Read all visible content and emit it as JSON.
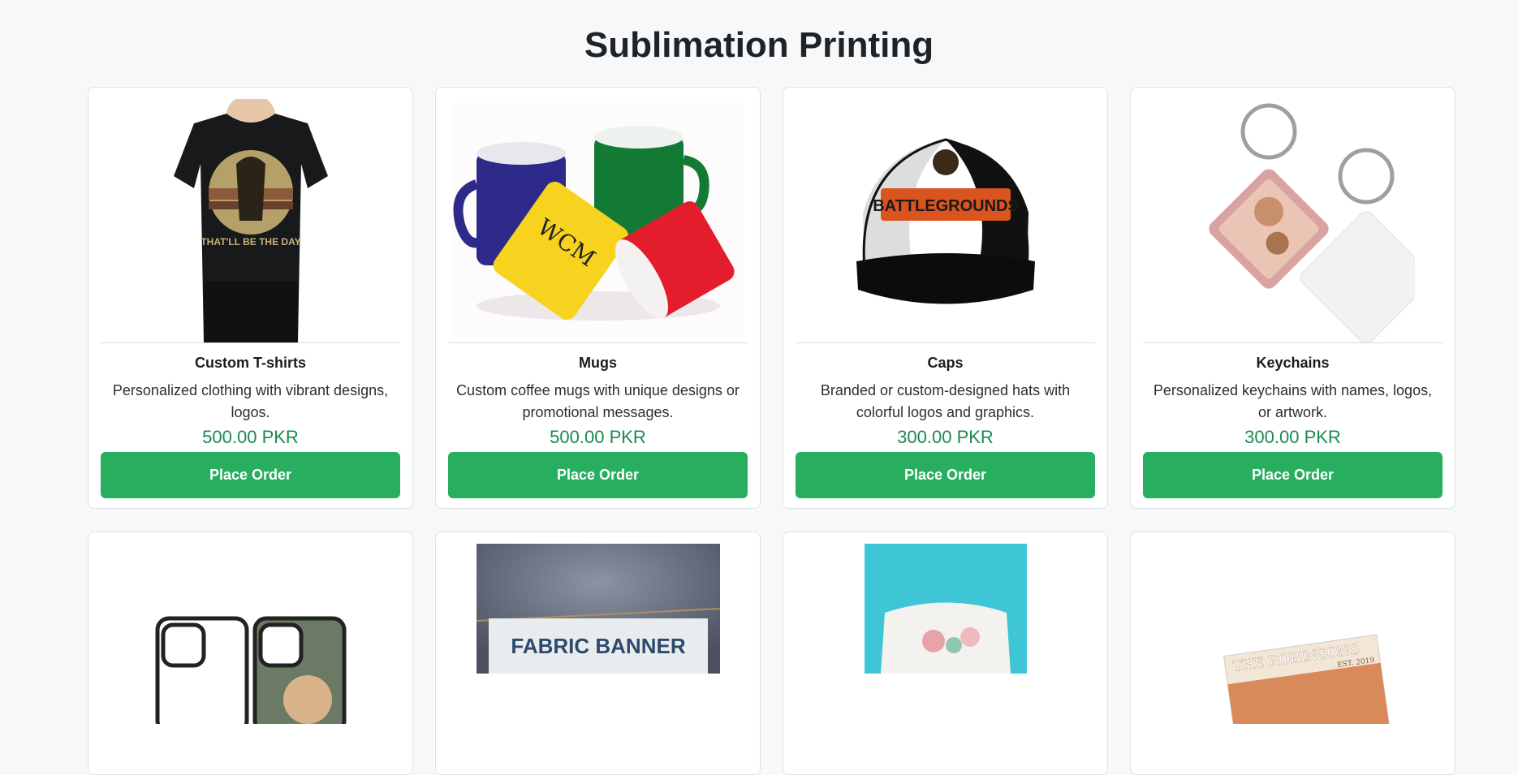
{
  "page": {
    "title": "Sublimation Printing"
  },
  "products": [
    {
      "name": "Custom T-shirts",
      "description": "Personalized clothing with vibrant designs, logos.",
      "price": "500.00 PKR",
      "button": "Place Order",
      "image": "tshirt-image"
    },
    {
      "name": "Mugs",
      "description": "Custom coffee mugs with unique designs or promotional messages.",
      "price": "500.00 PKR",
      "button": "Place Order",
      "image": "mugs-image"
    },
    {
      "name": "Caps",
      "description": "Branded or custom-designed hats with colorful logos and graphics.",
      "price": "300.00 PKR",
      "button": "Place Order",
      "image": "cap-image"
    },
    {
      "name": "Keychains",
      "description": "Personalized keychains with names, logos, or artwork.",
      "price": "300.00 PKR",
      "button": "Place Order",
      "image": "keychain-image"
    }
  ],
  "second_row": {
    "phone_case": {
      "image": "phone-case-image"
    },
    "banner": {
      "image": "fabric-banner-image",
      "text": "FABRIC BANNER"
    },
    "pillow": {
      "image": "pillow-image"
    },
    "photo_book": {
      "image": "photo-book-image",
      "title": "THE ROBINSONS",
      "subtitle": "EST. 2019"
    }
  },
  "colors": {
    "accent": "#27ae5f",
    "price": "#1e8a4c",
    "background": "#f7f8fa"
  }
}
